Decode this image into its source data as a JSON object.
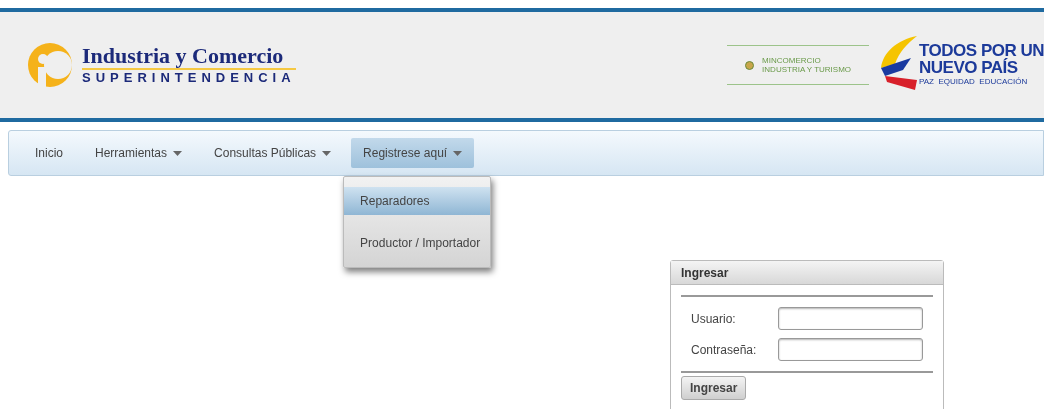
{
  "header": {
    "logo_title": "Industria y Comercio",
    "logo_subtitle": "SUPERINTENDENCIA",
    "ministry_lines": [
      "MINCOMERCIO",
      "INDUSTRIA Y TURISMO"
    ],
    "slogan_lines": [
      "TODOS POR UN",
      "NUEVO PAÍS"
    ],
    "slogan_tagline": "PAZ  EQUIDAD  EDUCACIÓN"
  },
  "nav": [
    {
      "label": "Inicio",
      "dropdown": false,
      "selected": false
    },
    {
      "label": "Herramientas",
      "dropdown": true,
      "selected": false
    },
    {
      "label": "Consultas Públicas",
      "dropdown": true,
      "selected": false
    },
    {
      "label": "Registrese aquí",
      "dropdown": true,
      "selected": true,
      "menu": [
        {
          "label": "Reparadores",
          "selected": true
        },
        {
          "label": "Productor / Importador",
          "selected": false
        }
      ]
    }
  ],
  "login": {
    "title": "Ingresar",
    "fields": [
      {
        "label": "Usuario:"
      },
      {
        "label": "Contraseña:"
      }
    ],
    "button": "Ingresar"
  }
}
